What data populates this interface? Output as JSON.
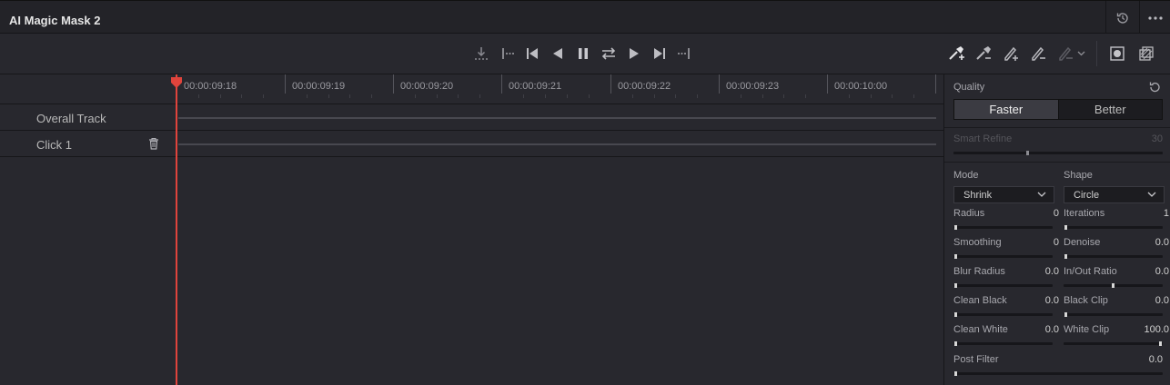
{
  "title": "AI Magic Mask 2",
  "header_icons": [
    {
      "name": "history-icon"
    },
    {
      "name": "more-options-icon"
    }
  ],
  "toolbar": {
    "transport": [
      {
        "name": "track-reverse-one-frame-icon"
      },
      {
        "name": "track-in-icon"
      },
      {
        "name": "go-to-first-frame-icon"
      },
      {
        "name": "play-reverse-icon"
      },
      {
        "name": "pause-icon"
      },
      {
        "name": "track-both-directions-icon"
      },
      {
        "name": "play-forward-icon"
      },
      {
        "name": "go-to-last-frame-icon"
      },
      {
        "name": "track-out-icon"
      }
    ],
    "tools": [
      {
        "name": "add-subject-picker-icon"
      },
      {
        "name": "remove-subject-picker-icon"
      },
      {
        "name": "add-stroke-icon"
      },
      {
        "name": "subtract-stroke-icon"
      },
      {
        "name": "stroke-options-dropdown-icon"
      },
      {
        "name": "mask-overlay-icon"
      },
      {
        "name": "mask-view-icon"
      }
    ]
  },
  "timeline": {
    "ticks": [
      "00:00:09:18",
      "00:00:09:19",
      "00:00:09:20",
      "00:00:09:21",
      "00:00:09:22",
      "00:00:09:23",
      "00:00:10:00"
    ],
    "tracks": [
      {
        "label": "Overall Track",
        "deletable": false
      },
      {
        "label": "Click 1",
        "deletable": true
      }
    ],
    "playhead_color": "#e0443c"
  },
  "inspector": {
    "quality": {
      "label": "Quality",
      "options": [
        "Faster",
        "Better"
      ],
      "selected": "Faster"
    },
    "smart_refine": {
      "label": "Smart Refine",
      "value": "30",
      "enabled": false,
      "level": 0.35
    },
    "mode": {
      "label": "Mode",
      "value": "Shrink"
    },
    "shape": {
      "label": "Shape",
      "value": "Circle"
    },
    "params_left": [
      {
        "label": "Radius",
        "value": "0",
        "level": 0
      },
      {
        "label": "Smoothing",
        "value": "0",
        "level": 0
      },
      {
        "label": "Blur Radius",
        "value": "0.0",
        "level": 0
      },
      {
        "label": "Clean Black",
        "value": "0.0",
        "level": 0
      },
      {
        "label": "Clean White",
        "value": "0.0",
        "level": 0
      }
    ],
    "params_right": [
      {
        "label": "Iterations",
        "value": "1",
        "level": 0
      },
      {
        "label": "Denoise",
        "value": "0.0",
        "level": 0
      },
      {
        "label": "In/Out Ratio",
        "value": "0.0",
        "level": 0.5
      },
      {
        "label": "Black Clip",
        "value": "0.0",
        "level": 0
      },
      {
        "label": "White Clip",
        "value": "100.0",
        "level": 1
      }
    ],
    "post_filter": {
      "label": "Post Filter",
      "value": "0.0",
      "level": 0
    }
  }
}
